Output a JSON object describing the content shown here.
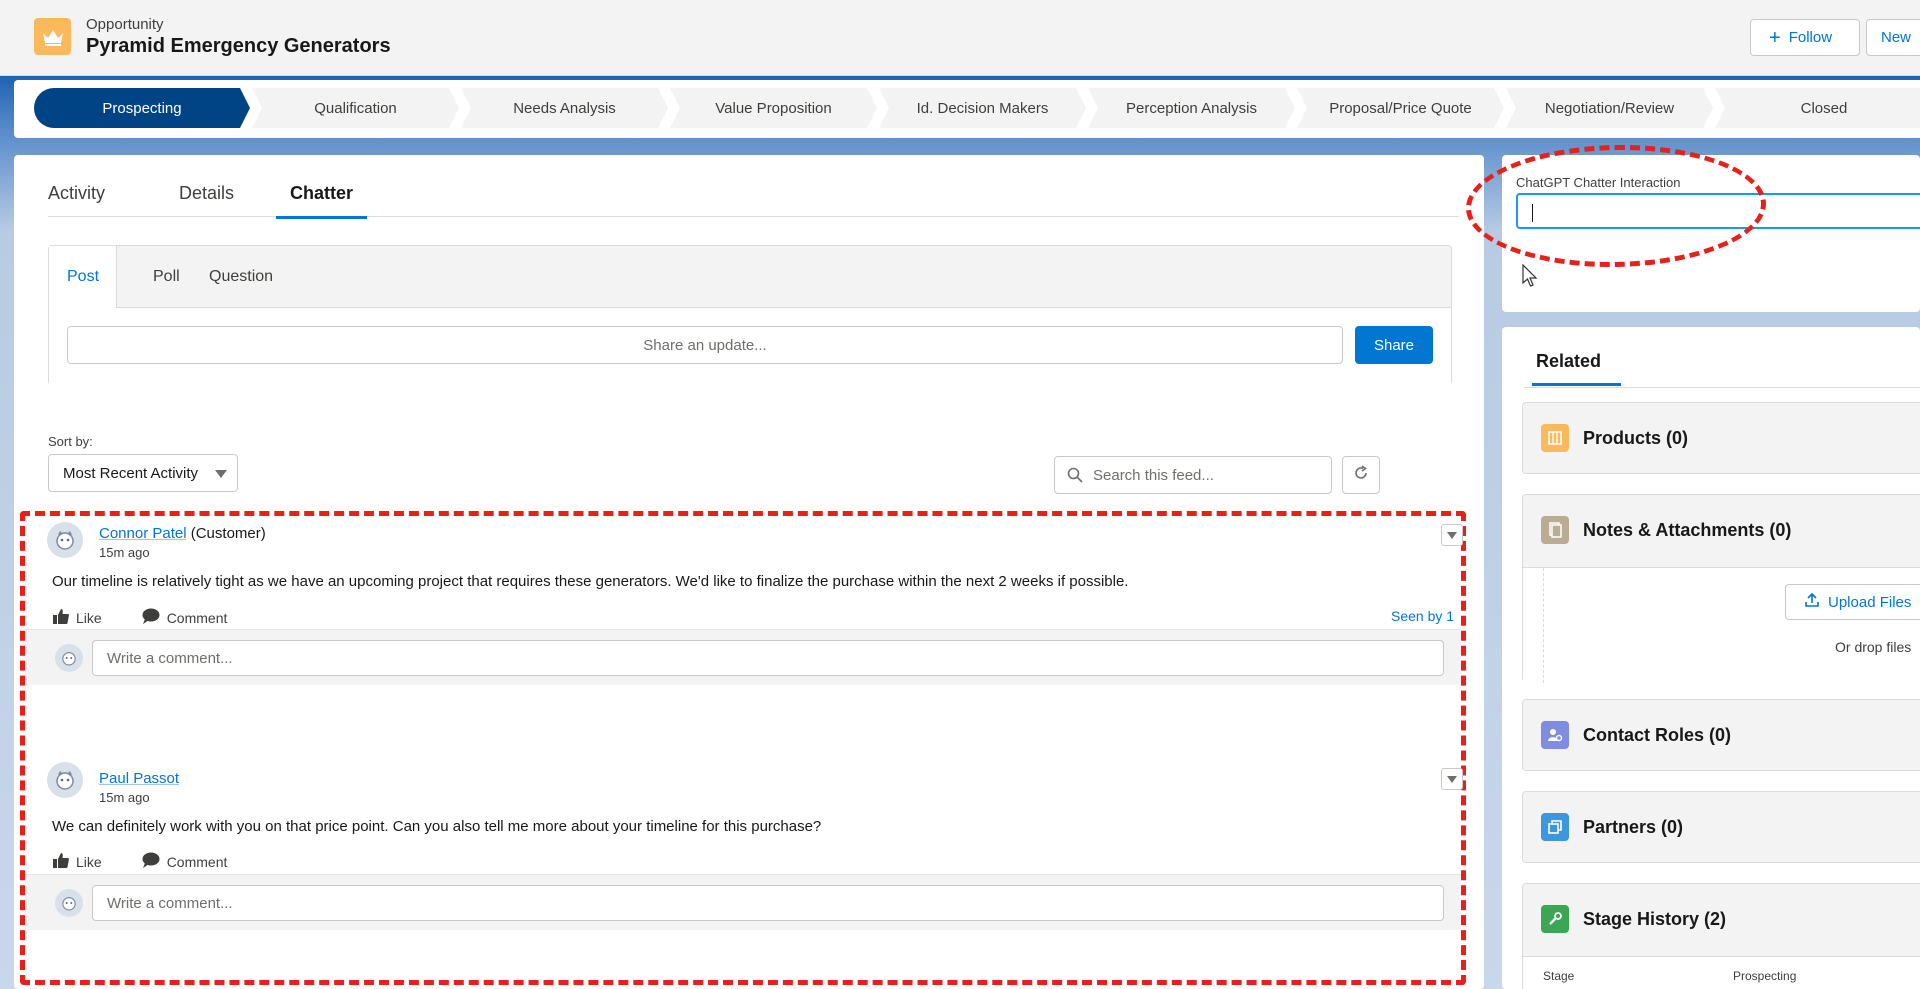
{
  "header": {
    "object_type": "Opportunity",
    "record_name": "Pyramid Emergency Generators",
    "follow_label": "Follow",
    "new_label": "New",
    "icon": "crown-icon",
    "icon_color": "#fcb95b"
  },
  "path": {
    "stages": [
      "Prospecting",
      "Qualification",
      "Needs Analysis",
      "Value Proposition",
      "Id. Decision Makers",
      "Perception Analysis",
      "Proposal/Price Quote",
      "Negotiation/Review",
      "Closed"
    ],
    "active_stage": "Prospecting",
    "active_color": "#014486"
  },
  "tabs": {
    "activity": "Activity",
    "details": "Details",
    "chatter": "Chatter",
    "active": "Chatter"
  },
  "publisher": {
    "tabs": [
      "Post",
      "Poll",
      "Question"
    ],
    "active_tab": "Post",
    "placeholder": "Share an update...",
    "share_label": "Share"
  },
  "feed_controls": {
    "sort_label": "Sort by:",
    "sort_value": "Most Recent Activity",
    "search_placeholder": "Search this feed..."
  },
  "feed": {
    "posts": [
      {
        "author": "Connor Patel",
        "role": "(Customer)",
        "time": "15m ago",
        "body": "Our timeline is relatively tight as we have an upcoming project that requires these generators. We'd like to finalize the purchase within the next 2 weeks if possible.",
        "like_label": "Like",
        "comment_label": "Comment",
        "seen": "Seen by 1",
        "comment_placeholder": "Write a comment..."
      },
      {
        "author": "Paul Passot",
        "role": "",
        "time": "15m ago",
        "body": "We can definitely work with you on that price point. Can you also tell me more about your timeline for this purchase?",
        "like_label": "Like",
        "comment_label": "Comment",
        "comment_placeholder": "Write a comment..."
      }
    ]
  },
  "gpt": {
    "label": "ChatGPT Chatter Interaction",
    "value": ""
  },
  "related": {
    "tab": "Related",
    "items": [
      {
        "label": "Products (0)",
        "icon": "products-icon",
        "color": "#fcb95b"
      },
      {
        "label": "Notes & Attachments (0)",
        "icon": "notes-icon",
        "color": "#baac93"
      },
      {
        "label": "Contact Roles (0)",
        "icon": "contact-roles-icon",
        "color": "#7f8de1"
      },
      {
        "label": "Partners (0)",
        "icon": "partners-icon",
        "color": "#3c97dd"
      },
      {
        "label": "Stage History (2)",
        "icon": "stage-history-icon",
        "color": "#3ba755"
      }
    ],
    "upload_label": "Upload Files",
    "drop_text": "Or drop files",
    "stage_history_cols": [
      "Stage",
      "Prospecting"
    ]
  },
  "annotations": {
    "highlight_color": "#e8201a"
  }
}
